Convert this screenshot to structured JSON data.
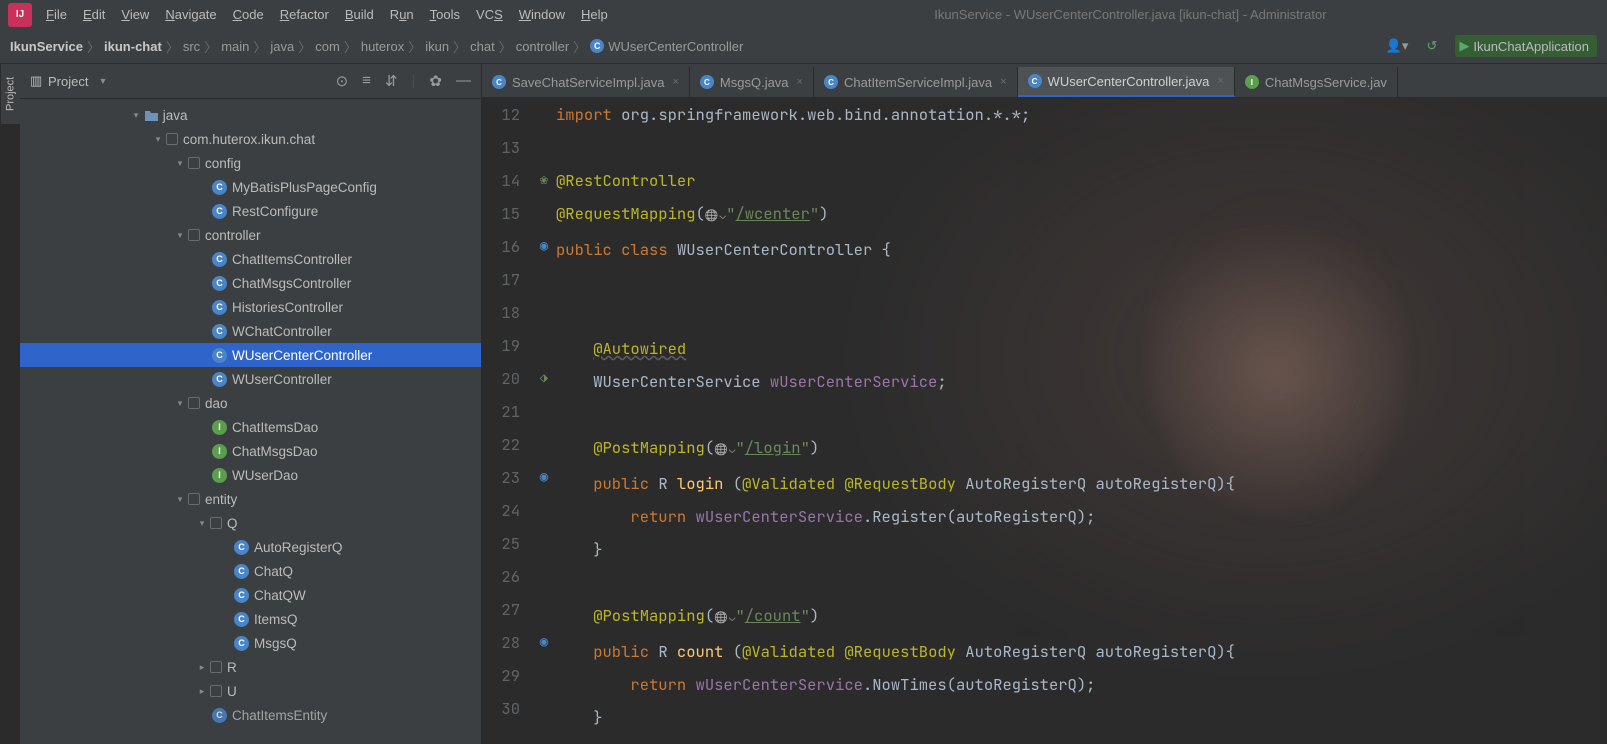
{
  "window_title": "IkunService - WUserCenterController.java [ikun-chat] - Administrator",
  "menu": [
    "File",
    "Edit",
    "View",
    "Navigate",
    "Code",
    "Refactor",
    "Build",
    "Run",
    "Tools",
    "VCS",
    "Window",
    "Help"
  ],
  "breadcrumb": [
    "IkunService",
    "ikun-chat",
    "src",
    "main",
    "java",
    "com",
    "huterox",
    "ikun",
    "chat",
    "controller",
    "WUserCenterController"
  ],
  "run_config": "IkunChatApplication",
  "project_label": "Project",
  "left_tab": "Project",
  "tree": {
    "java": "java",
    "pkg": "com.huterox.ikun.chat",
    "config": "config",
    "config_items": [
      "MyBatisPlusPageConfig",
      "RestConfigure"
    ],
    "controller": "controller",
    "controller_items": [
      "ChatItemsController",
      "ChatMsgsController",
      "HistoriesController",
      "WChatController",
      "WUserCenterController",
      "WUserController"
    ],
    "dao": "dao",
    "dao_items": [
      "ChatItemsDao",
      "ChatMsgsDao",
      "WUserDao"
    ],
    "entity": "entity",
    "Q": "Q",
    "Q_items": [
      "AutoRegisterQ",
      "ChatQ",
      "ChatQW",
      "ItemsQ",
      "MsgsQ"
    ],
    "R": "R",
    "U": "U",
    "ChatItemsEntity": "ChatItemsEntity"
  },
  "tabs": [
    "SaveChatServiceImpl.java",
    "MsgsQ.java",
    "ChatItemServiceImpl.java",
    "WUserCenterController.java",
    "ChatMsgsService.jav"
  ],
  "active_tab": 3,
  "code": {
    "lines": [
      12,
      13,
      14,
      15,
      16,
      17,
      18,
      19,
      20,
      21,
      22,
      23,
      24,
      25,
      26,
      27,
      28,
      29,
      30
    ],
    "import": "org.springframework.web.bind.annotation.*",
    "ann_rest": "@RestController",
    "ann_reqmap": "@RequestMapping",
    "path_wcenter": "/wcenter",
    "public": "public",
    "class": "class",
    "classname": "WUserCenterController",
    "ann_autowired": "@Autowired",
    "svc_type": "WUserCenterService",
    "svc_name": "wUserCenterService",
    "ann_post": "@PostMapping",
    "path_login": "/login",
    "path_count": "/count",
    "R": "R",
    "fn_login": "login",
    "fn_count": "count",
    "ann_valid": "@Validated",
    "ann_body": "@RequestBody",
    "param_type": "AutoRegisterQ",
    "param_name": "autoRegisterQ",
    "return": "return",
    "m_register": "Register",
    "m_nowtimes": "NowTimes"
  }
}
